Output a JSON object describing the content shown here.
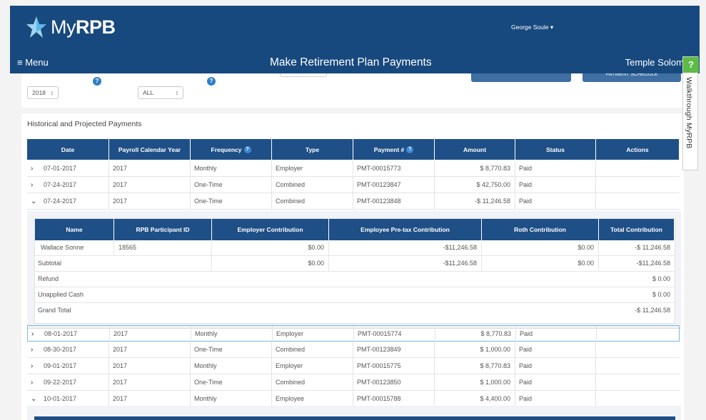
{
  "app": {
    "logo_prefix": "My",
    "logo_brand": "RPB",
    "user_name": "George Soule ▾",
    "menu_label": "≡ Menu",
    "page_title": "Make Retirement Plan Payments",
    "org_name": "Temple Solom"
  },
  "filters": {
    "year": "2018",
    "type": "ALL",
    "spinner": "↕",
    "payment_schedule_label": "PAYMENT SCHEDULE",
    "help": "?"
  },
  "section_title": "Historical and Projected Payments",
  "columns": [
    "Date",
    "Payroll Calendar Year",
    "Frequency",
    "Type",
    "Payment #",
    "Amount",
    "Status",
    "Actions"
  ],
  "rows_top": [
    {
      "chev": "›",
      "date": "07-01-2017",
      "year": "2017",
      "freq": "Monthly",
      "type": "Employer",
      "pmt": "PMT-00015773",
      "amount": "$ 8,770.83",
      "status": "Paid"
    },
    {
      "chev": "›",
      "date": "07-24-2017",
      "year": "2017",
      "freq": "One-Time",
      "type": "Combined",
      "pmt": "PMT-00123847",
      "amount": "$ 42,750.00",
      "status": "Paid"
    },
    {
      "chev": "⌄",
      "date": "07-24-2017",
      "year": "2017",
      "freq": "One-Time",
      "type": "Combined",
      "pmt": "PMT-00123848",
      "amount": "-$ 11,246.58",
      "status": "Paid"
    }
  ],
  "detail": {
    "columns": [
      "Name",
      "RPB Participant ID",
      "Employer Contribution",
      "Employee Pre-tax Contribution",
      "Roth Contribution",
      "Total Contribution"
    ],
    "participant": {
      "name": "Wallace Sonne",
      "id": "18565",
      "employer": "$0.00",
      "pretax": "-$11,246.58",
      "roth": "$0.00",
      "total": "-$ 11,246.58"
    },
    "subtotal": {
      "label": "Subtotal",
      "employer": "$0.00",
      "pretax": "-$11,246.58",
      "roth": "$0.00",
      "total": "-$11,246.58"
    },
    "refund": {
      "label": "Refund",
      "value": "$ 0.00"
    },
    "unapplied": {
      "label": "Unapplied Cash",
      "value": "$ 0.00"
    },
    "grand_total": {
      "label": "Grand Total",
      "value": "-$ 11,246.58"
    }
  },
  "rows_bottom": [
    {
      "chev": "›",
      "date": "08-01-2017",
      "year": "2017",
      "freq": "Monthly",
      "type": "Employer",
      "pmt": "PMT-00015774",
      "amount": "$ 8,770.83",
      "status": "Paid"
    },
    {
      "chev": "›",
      "date": "08-30-2017",
      "year": "2017",
      "freq": "One-Time",
      "type": "Combined",
      "pmt": "PMT-00123849",
      "amount": "$ 1,000.00",
      "status": "Paid"
    },
    {
      "chev": "›",
      "date": "09-01-2017",
      "year": "2017",
      "freq": "Monthly",
      "type": "Employer",
      "pmt": "PMT-00015775",
      "amount": "$ 8,770.83",
      "status": "Paid"
    },
    {
      "chev": "›",
      "date": "09-22-2017",
      "year": "2017",
      "freq": "One-Time",
      "type": "Combined",
      "pmt": "PMT-00123850",
      "amount": "$ 1,000.00",
      "status": "Paid"
    },
    {
      "chev": "⌄",
      "date": "10-01-2017",
      "year": "2017",
      "freq": "Monthly",
      "type": "Employee",
      "pmt": "PMT-00015788",
      "amount": "$ 4,400.00",
      "status": "Paid"
    }
  ],
  "walkthrough": {
    "q": "?",
    "label": "Walkthrough MyRPB"
  },
  "colors": {
    "header": "#17497e",
    "table_header": "#1e4f86",
    "accent_green": "#5dbb46"
  }
}
